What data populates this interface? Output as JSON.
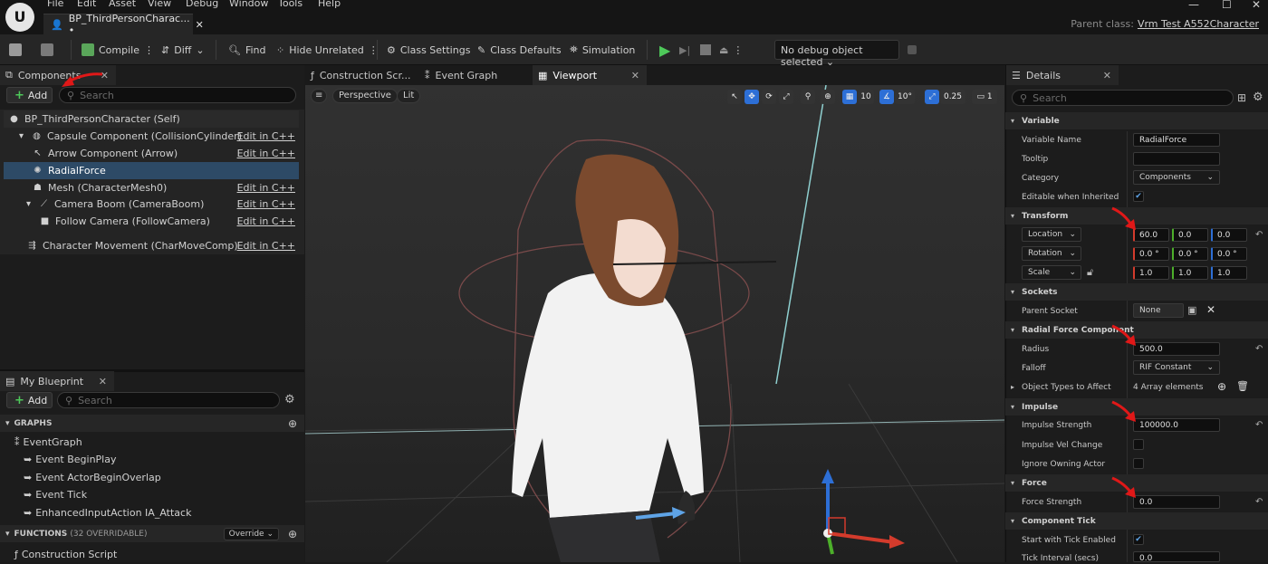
{
  "menu": [
    "File",
    "Edit",
    "Asset",
    "View",
    "Debug",
    "Window",
    "Tools",
    "Help"
  ],
  "doc_tab": "BP_ThirdPersonCharac... •",
  "parent_class": {
    "label": "Parent class:",
    "value": "Vrm Test A552Character"
  },
  "toolbar": {
    "compile": "Compile",
    "diff": "Diff",
    "find": "Find",
    "hide_unrelated": "Hide Unrelated",
    "class_settings": "Class Settings",
    "class_defaults": "Class Defaults",
    "simulation": "Simulation",
    "debug_object": "No debug object selected"
  },
  "components_panel": {
    "tab": "Components",
    "add": "Add",
    "search_placeholder": "Search",
    "items": [
      {
        "label": "BP_ThirdPersonCharacter (Self)",
        "link": ""
      },
      {
        "label": "Capsule Component (CollisionCylinder)",
        "link": "Edit in C++"
      },
      {
        "label": "Arrow Component (Arrow)",
        "link": "Edit in C++"
      },
      {
        "label": "RadialForce",
        "link": ""
      },
      {
        "label": "Mesh (CharacterMesh0)",
        "link": "Edit in C++"
      },
      {
        "label": "Camera Boom (CameraBoom)",
        "link": "Edit in C++"
      },
      {
        "label": "Follow Camera (FollowCamera)",
        "link": "Edit in C++"
      },
      {
        "label": "Character Movement (CharMoveComp)",
        "link": "Edit in C++"
      }
    ]
  },
  "my_blueprint": {
    "tab": "My Blueprint",
    "add": "Add",
    "search_placeholder": "Search",
    "graphs_header": "GRAPHS",
    "graphs": [
      "EventGraph",
      "Event BeginPlay",
      "Event ActorBeginOverlap",
      "Event Tick",
      "EnhancedInputAction IA_Attack"
    ],
    "functions_header": "FUNCTIONS",
    "functions_count": "(32 OVERRIDABLE)",
    "override": "Override",
    "functions": [
      "Construction Script"
    ]
  },
  "center_tabs": [
    "Construction Scr...",
    "Event Graph",
    "Viewport"
  ],
  "viewport": {
    "perspective": "Perspective",
    "lit": "Lit",
    "grid_snap": "10",
    "rot_snap": "10°",
    "scale_snap": "0.25",
    "cam_speed": "1"
  },
  "details": {
    "tab": "Details",
    "search_placeholder": "Search",
    "variable_header": "Variable",
    "variable_name_label": "Variable Name",
    "variable_name": "RadialForce",
    "tooltip_label": "Tooltip",
    "category_label": "Category",
    "category": "Components",
    "editable_label": "Editable when Inherited",
    "transform_header": "Transform",
    "location_label": "Location",
    "location": [
      "60.0",
      "0.0",
      "0.0"
    ],
    "rotation_label": "Rotation",
    "rotation": [
      "0.0 °",
      "0.0 °",
      "0.0 °"
    ],
    "scale_label": "Scale",
    "scale": [
      "1.0",
      "1.0",
      "1.0"
    ],
    "sockets_header": "Sockets",
    "parent_socket_label": "Parent Socket",
    "parent_socket": "None",
    "radial_header": "Radial Force Component",
    "radius_label": "Radius",
    "radius": "500.0",
    "falloff_label": "Falloff",
    "falloff": "RIF Constant",
    "object_types_label": "Object Types to Affect",
    "object_types": "4 Array elements",
    "impulse_header": "Impulse",
    "impulse_strength_label": "Impulse Strength",
    "impulse_strength": "100000.0",
    "impulse_vel_label": "Impulse Vel Change",
    "ignore_owning_label": "Ignore Owning Actor",
    "force_header": "Force",
    "force_strength_label": "Force Strength",
    "force_strength": "0.0",
    "component_tick_header": "Component Tick",
    "start_tick_label": "Start with Tick Enabled",
    "tick_interval_label": "Tick Interval (secs)",
    "tick_interval": "0.0"
  },
  "colors": {
    "accent": "#2d4a66",
    "x_axis": "#d33b2c",
    "y_axis": "#4caf2a",
    "z_axis": "#2d6fd6",
    "play": "#4ec95a"
  }
}
